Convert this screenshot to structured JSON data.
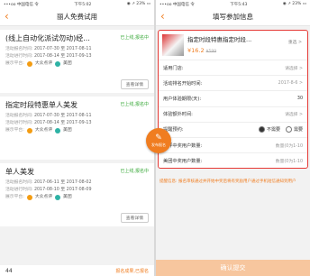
{
  "left": {
    "status": {
      "carrier": "•••oo 中国电信 令",
      "time": "下午5:02",
      "battery": "◉ ↗ 23% ▭"
    },
    "title": "丽人免费试用",
    "cards": [
      {
        "title": "(线上自动化派试勿动)经...",
        "status": "已上线,报名中",
        "r1l": "活动报名时间:",
        "r1v": "2017-07-30 至 2017-08-11",
        "r2l": "活动进行时间:",
        "r2v": "2017-08-14 至 2017-09-13",
        "pl": "展示平台:",
        "p1": "大众点评",
        "p2": "美团",
        "btn": "查看详情"
      },
      {
        "title": "指定时段特惠单人美发",
        "status": "已上线,报名中",
        "r1l": "活动报名时间:",
        "r1v": "2017-07-30 至 2017-08-11",
        "r2l": "活动进行时间:",
        "r2v": "2017-08-14 至 2017-09-13",
        "pl": "展示平台:",
        "p1": "大众点评",
        "p2": "美团"
      },
      {
        "title": "单人美发",
        "status": "已上线,报名中",
        "r1l": "活动报名时间:",
        "r1v": "2017-06-11 至 2017-08-02",
        "r2l": "活动进行时间:",
        "r2v": "2017-08-10 至 2017-08-09",
        "pl": "展示平台:",
        "p1": "大众点评",
        "p2": "美团",
        "btn": "查看详情"
      }
    ],
    "fab": "发布报名",
    "footer": {
      "count": "44",
      "state": "报名成果,已报名"
    }
  },
  "right": {
    "status": {
      "carrier": "•••oo 中国电信 令",
      "time": "下午5:43",
      "battery": "◉ ↗ 23% ▭"
    },
    "title": "填写参加信息",
    "product": {
      "name": "指定时段特惠指定时段...",
      "price": "¥16.2",
      "old": "¥599",
      "swap": "重选 >"
    },
    "rows": [
      {
        "label": "适用门店:",
        "value": "请选择 >"
      },
      {
        "label": "活动排名开始时间:",
        "value": "2017-8-6 >"
      },
      {
        "label": "用户体验期限(天):",
        "value": "30"
      },
      {
        "label": "体验额外时间:",
        "value": "请选择 >"
      },
      {
        "label": "点评中奖用户数量:",
        "value": "数量(0为1-10"
      },
      {
        "label": "美团中奖用户数量:",
        "value": "数量(0为1-10"
      }
    ],
    "remind": {
      "label": "提醒预约:",
      "opt1": "不需要",
      "opt2": "需要"
    },
    "note": "提醒信息: 报名审核通过并开始中奖后将有奖励用户通过手机短信通知到用户",
    "submit": "确认提交"
  }
}
